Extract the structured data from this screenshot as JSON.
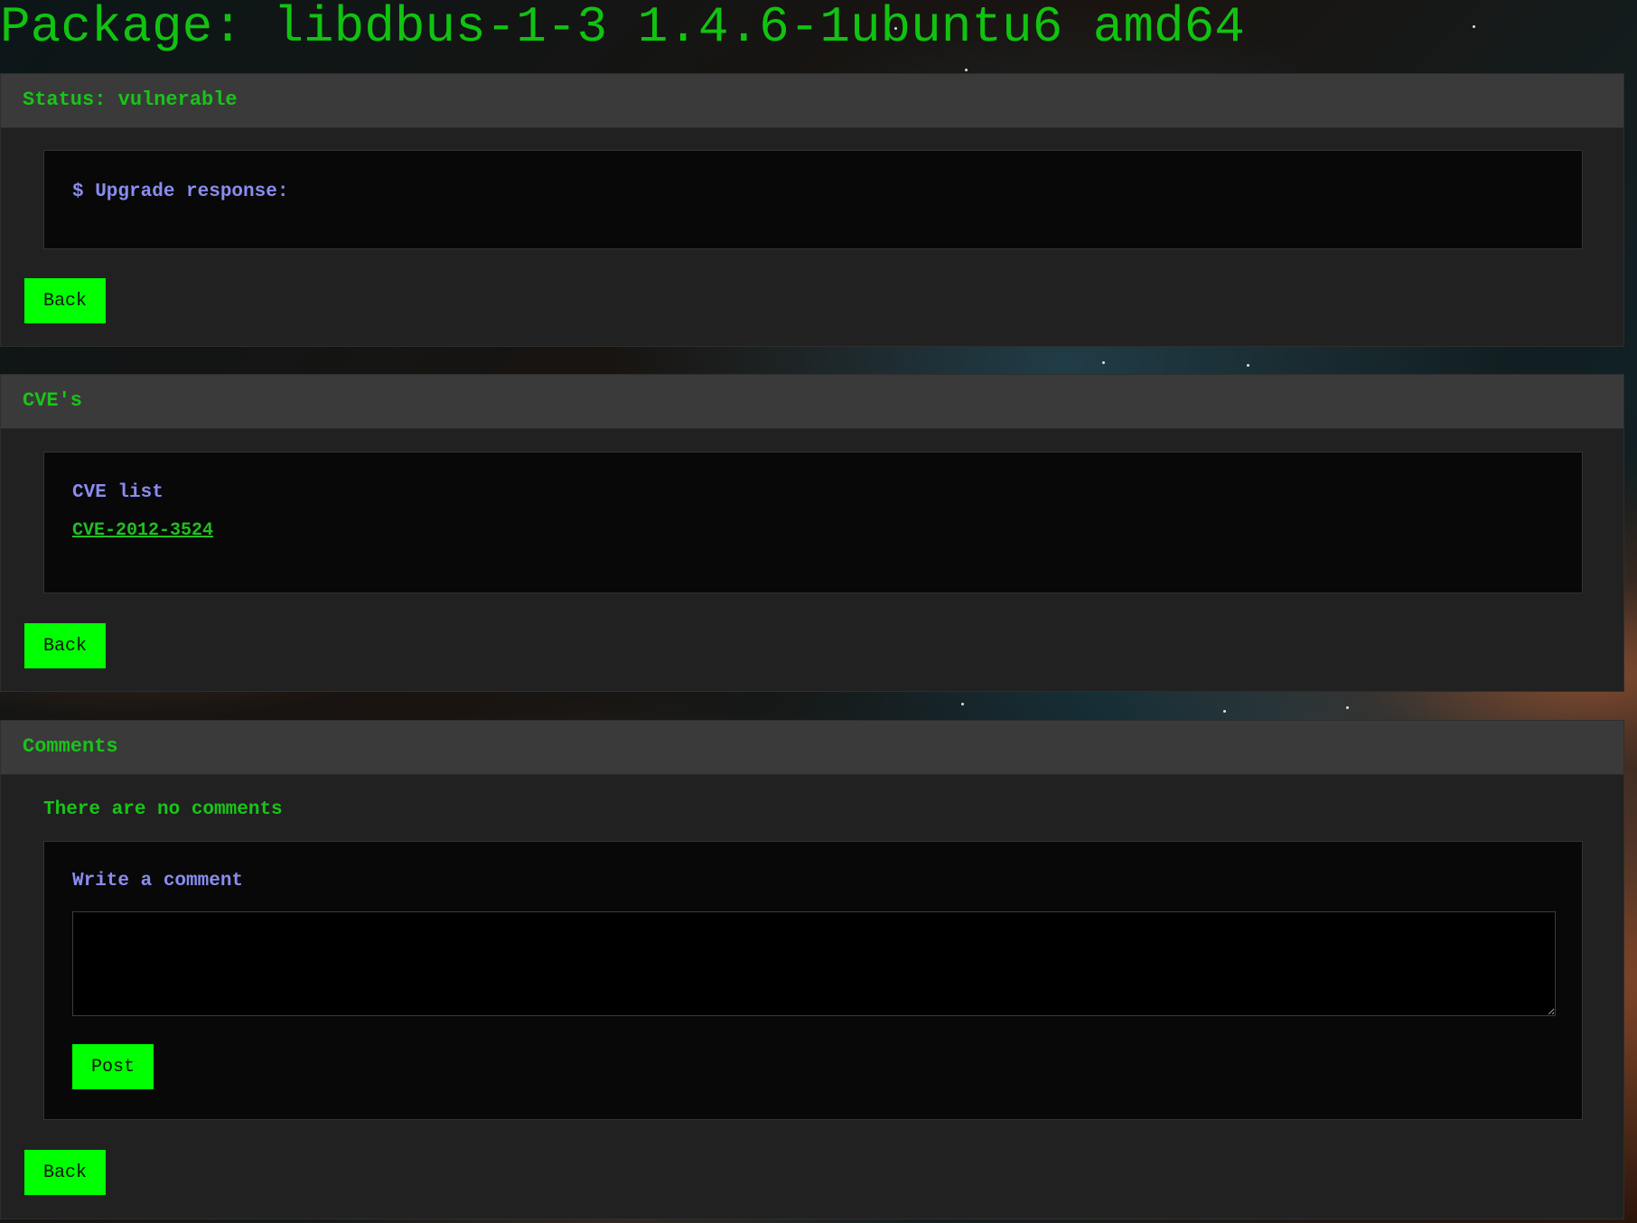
{
  "page": {
    "title": "Package: libdbus-1-3 1.4.6-1ubuntu6 amd64"
  },
  "status_panel": {
    "header": "Status: vulnerable",
    "console_text": "$ Upgrade response:",
    "back_label": "Back"
  },
  "cve_panel": {
    "header": "CVE's",
    "list_label": "CVE list",
    "cves": [
      "CVE-2012-3524"
    ],
    "back_label": "Back"
  },
  "comments_panel": {
    "header": "Comments",
    "empty_message": "There are no comments",
    "form_label": "Write a comment",
    "comment_value": "",
    "post_label": "Post",
    "back_label": "Back"
  },
  "colors": {
    "accent_green": "#00ff00",
    "text_green": "#18c518",
    "label_blue": "#8a8cf0"
  }
}
